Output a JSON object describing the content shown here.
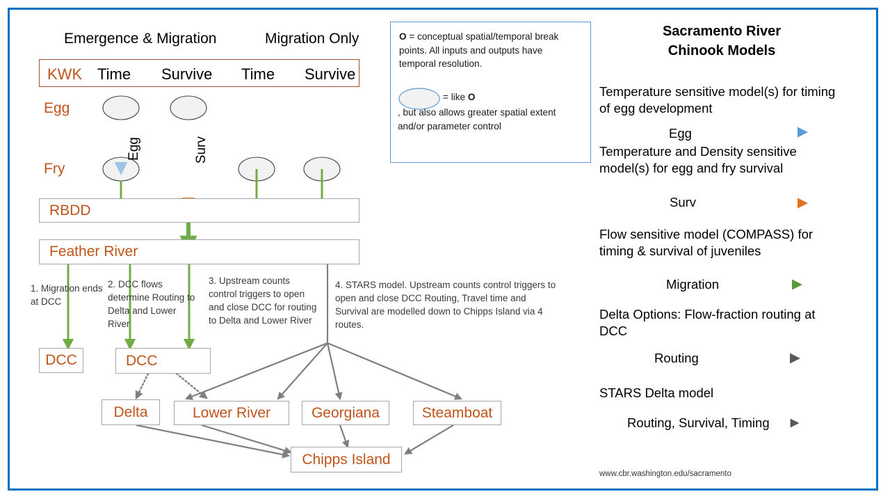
{
  "frame": {
    "border_color": "#0070c0"
  },
  "colors": {
    "orange_text": "#c0541a",
    "egg_blue": "#5b9bd5",
    "surv_orange": "#ed7d31",
    "migration_green": "#70ad47",
    "routing_gray": "#7f7f7f",
    "stars_gray": "#595959",
    "box_border": "#a6a6a6",
    "kwk_border": "#a0522d",
    "legend_border": "#5b9bd5"
  },
  "column_headings": [
    {
      "label": "Emergence & Migration"
    },
    {
      "label": "Migration Only"
    }
  ],
  "kwk_header": {
    "cells": [
      {
        "label": "KWK",
        "accent": true
      },
      {
        "label": "Time",
        "accent": false
      },
      {
        "label": "Survive",
        "accent": false
      },
      {
        "label": "Time",
        "accent": false
      },
      {
        "label": "Survive",
        "accent": false
      }
    ]
  },
  "stage_labels": [
    {
      "label": "Egg"
    },
    {
      "label": "Fry"
    }
  ],
  "bands": [
    {
      "label": "RBDD"
    },
    {
      "label": "Feather River"
    }
  ],
  "arrow_labels": [
    {
      "label": "Egg"
    },
    {
      "label": "Surv"
    }
  ],
  "notes": [
    {
      "id": "note1",
      "text": "1. Migration ends at DCC"
    },
    {
      "id": "note2",
      "text": "2. DCC flows determine Routing to Delta and Lower River"
    },
    {
      "id": "note3",
      "text": "3. Upstream counts control triggers to open and close DCC for routing to Delta and Lower River"
    },
    {
      "id": "note4",
      "text": "4. STARS model.  Upstream counts control triggers to open and close DCC Routing, Travel time and Survival are modelled down to Chipps Island via 4 routes."
    }
  ],
  "nodes": [
    {
      "id": "dcc-left",
      "label": "DCC"
    },
    {
      "id": "dcc-main",
      "label": "DCC"
    },
    {
      "id": "delta",
      "label": "Delta"
    },
    {
      "id": "lower-river",
      "label": "Lower River"
    },
    {
      "id": "georgiana",
      "label": "Georgiana"
    },
    {
      "id": "steamboat",
      "label": "Steamboat"
    },
    {
      "id": "chipps-island",
      "label": "Chipps Island"
    }
  ],
  "legend_box": {
    "line1_bold": "O",
    "line1_rest": " = conceptual spatial/temporal break points. All inputs and outputs have temporal resolution.",
    "line2_pre": " = like ",
    "line2_bold": "O",
    "line2_rest": ", but also allows greater spatial extent and/or parameter control"
  },
  "right_panel": {
    "title_line1": "Sacramento River",
    "title_line2": "Chinook Models",
    "entries": [
      {
        "description": "Temperature sensitive model(s) for timing of egg development",
        "arrow_label": "Egg",
        "arrow_color": "#5b9bd5",
        "arrow_style": "solid"
      },
      {
        "description": "Temperature and Density sensitive model(s) for egg and fry survival",
        "arrow_label": "Surv",
        "arrow_color": "#ed7d31",
        "arrow_style": "solid"
      },
      {
        "description": "Flow sensitive model (COMPASS) for timing & survival of juveniles",
        "arrow_label": "Migration",
        "arrow_color": "#70ad47",
        "arrow_style": "solid"
      },
      {
        "description": "Delta Options: Flow-fraction routing at DCC",
        "arrow_label": "Routing",
        "arrow_color": "#7f7f7f",
        "arrow_style": "dashed"
      },
      {
        "description": "STARS  Delta model",
        "arrow_label": "Routing,  Survival,  Timing",
        "arrow_color": "#595959",
        "arrow_style": "solid"
      }
    ],
    "url": "www.cbr.washington.edu/sacramento"
  }
}
